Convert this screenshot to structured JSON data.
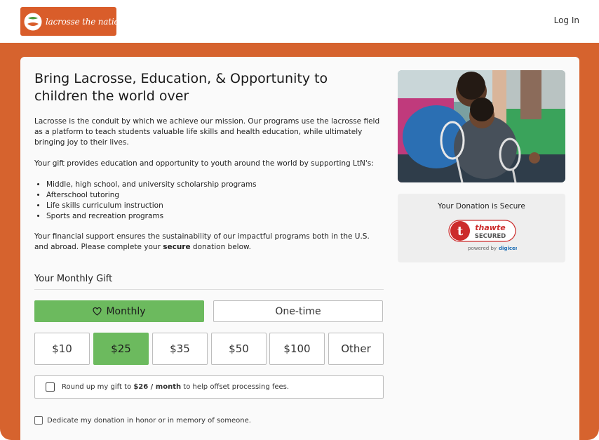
{
  "header": {
    "logo_text": "lacrosse the nations",
    "login_label": "Log In"
  },
  "intro": {
    "title": "Bring Lacrosse, Education, & Opportunity to children the world over",
    "paragraph1": "Lacrosse is the conduit by which we achieve our mission. Our programs use the lacrosse field as a platform to teach students valuable life skills and health education, while ultimately bringing joy to their lives.",
    "paragraph2": "Your gift provides education and opportunity to youth around the world by supporting LtN's:",
    "bullets": [
      "Middle, high school, and university scholarship programs",
      "Afterschool tutoring",
      "Life skills curriculum instruction",
      "Sports and recreation programs"
    ],
    "paragraph3_before": "Your financial support ensures the sustainability of our impactful programs both in the U.S. and abroad. Please complete your ",
    "paragraph3_bold": "secure",
    "paragraph3_after": " donation below."
  },
  "gift": {
    "section_title": "Your Monthly Gift",
    "frequency": {
      "monthly_label": "Monthly",
      "onetime_label": "One-time",
      "selected": "Monthly"
    },
    "amounts": [
      "$10",
      "$25",
      "$35",
      "$50",
      "$100",
      "Other"
    ],
    "selected_amount": "$25",
    "roundup_before": "Round up my gift to ",
    "roundup_bold": "$26 / month",
    "roundup_after": " to help offset processing fees.",
    "dedicate_label": "Dedicate my donation in honor or in memory of someone."
  },
  "secure": {
    "title": "Your Donation is Secure",
    "badge_brand": "thawte",
    "badge_text": "SECURED",
    "powered_by": "powered by",
    "powered_brand": "digicert"
  },
  "colors": {
    "brand_orange": "#d6632e",
    "selected_green": "#6cba5e"
  }
}
